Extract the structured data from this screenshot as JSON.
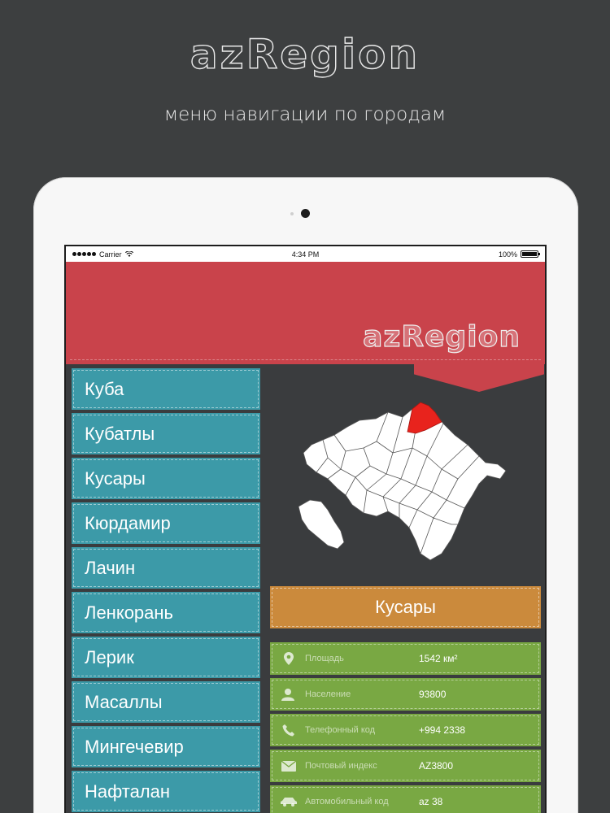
{
  "promo": {
    "title": "azRegion",
    "subtitle": "меню навигации по городам"
  },
  "status_bar": {
    "carrier": "Carrier",
    "time": "4:34 PM",
    "battery": "100%"
  },
  "header": {
    "logo": "azRegion",
    "color": "#c9434b"
  },
  "cities": [
    {
      "label": "Куба"
    },
    {
      "label": "Кубатлы"
    },
    {
      "label": "Кусары"
    },
    {
      "label": "Кюрдамир"
    },
    {
      "label": "Лачин"
    },
    {
      "label": "Ленкорань"
    },
    {
      "label": "Лерик"
    },
    {
      "label": "Масаллы"
    },
    {
      "label": "Мингечевир"
    },
    {
      "label": "Нафталан"
    }
  ],
  "selected_city": "Кусары",
  "info": [
    {
      "icon": "map-pin-icon",
      "label": "Площадь",
      "value": "1542 км²"
    },
    {
      "icon": "person-icon",
      "label": "Население",
      "value": "93800"
    },
    {
      "icon": "phone-icon",
      "label": "Телефонный код",
      "value": "+994 2338"
    },
    {
      "icon": "envelope-icon",
      "label": "Почтовый индекс",
      "value": "AZ3800"
    },
    {
      "icon": "car-icon",
      "label": "Автомобильный код",
      "value": "az 38"
    }
  ],
  "colors": {
    "background": "#3d3f40",
    "list_item": "#3c9aa8",
    "selected": "#cb8a3c",
    "info_row": "#79a843",
    "highlight_region": "#e8231d"
  }
}
